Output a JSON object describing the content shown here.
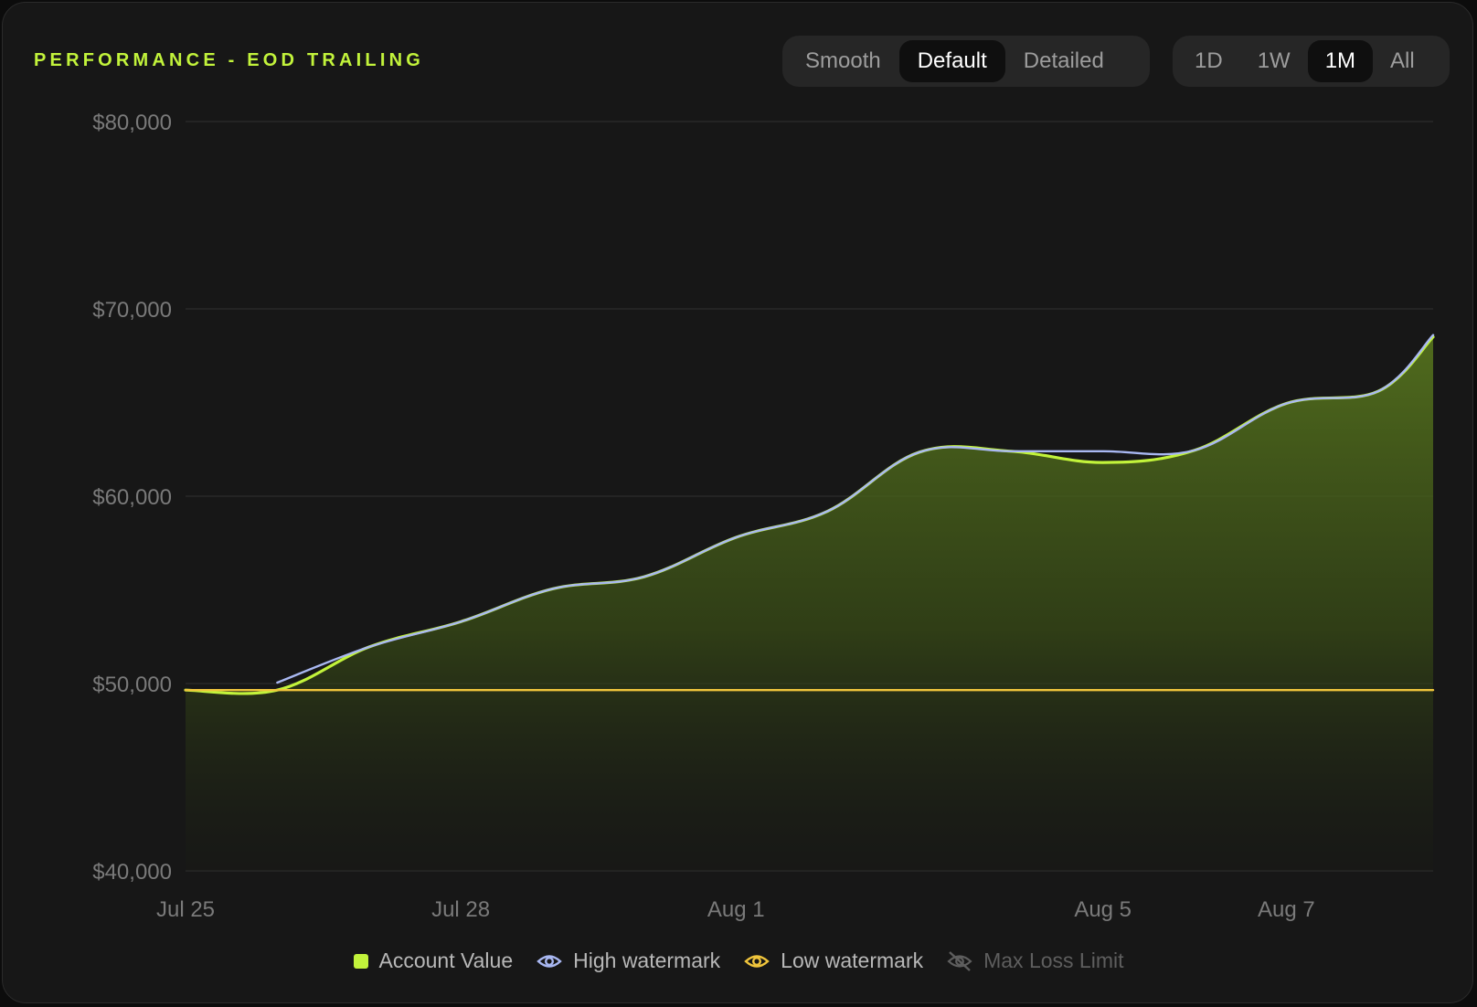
{
  "title": "PERFORMANCE - EOD TRAILING",
  "smoothing_options": [
    {
      "label": "Smooth",
      "active": false
    },
    {
      "label": "Default",
      "active": true
    },
    {
      "label": "Detailed",
      "active": false
    }
  ],
  "range_options": [
    {
      "label": "1D",
      "active": false
    },
    {
      "label": "1W",
      "active": false
    },
    {
      "label": "1M",
      "active": true
    },
    {
      "label": "All",
      "active": false
    }
  ],
  "legend": [
    {
      "label": "Account Value",
      "icon": "square-icon",
      "color": "#c2f33b",
      "visible": true
    },
    {
      "label": "High watermark",
      "icon": "eye-icon",
      "color": "#a9b8f2",
      "visible": true
    },
    {
      "label": "Low watermark",
      "icon": "eye-icon",
      "color": "#f0c53c",
      "visible": true
    },
    {
      "label": "Max Loss Limit",
      "icon": "eye-off-icon",
      "color": "#5e5e5e",
      "visible": false
    }
  ],
  "chart_data": {
    "type": "area",
    "ylim": [
      40000,
      80000
    ],
    "yticks": [
      40000,
      50000,
      60000,
      70000,
      80000
    ],
    "ytick_labels": [
      "$40,000",
      "$50,000",
      "$60,000",
      "$70,000",
      "$80,000"
    ],
    "xlim": [
      0,
      13.6
    ],
    "xticks": [
      0,
      3,
      6,
      10,
      12
    ],
    "xtick_labels": [
      "Jul 25",
      "Jul 28",
      "Aug 1",
      "Aug 5",
      "Aug 7"
    ],
    "grid": true,
    "series": [
      {
        "name": "Account Value",
        "color": "#c2f33b",
        "fill": true,
        "x": [
          0,
          1,
          2,
          3,
          4,
          5,
          6,
          7,
          8,
          9,
          10,
          11,
          12,
          13,
          13.6
        ],
        "values": [
          49650,
          49650,
          51950,
          53300,
          55050,
          55700,
          57800,
          59200,
          62350,
          62400,
          61800,
          62450,
          64950,
          65600,
          68500
        ]
      },
      {
        "name": "High watermark",
        "color": "#a9b8f2",
        "fill": false,
        "x": [
          1,
          2,
          3,
          4,
          5,
          6,
          7,
          8,
          9,
          10,
          11,
          12,
          13,
          13.6
        ],
        "values": [
          50050,
          51950,
          53300,
          55050,
          55700,
          57800,
          59200,
          62350,
          62400,
          62400,
          62450,
          64950,
          65600,
          68600
        ]
      },
      {
        "name": "Low watermark",
        "color": "#f0c53c",
        "fill": false,
        "x": [
          0,
          13.6
        ],
        "values": [
          49650,
          49650
        ]
      }
    ]
  }
}
